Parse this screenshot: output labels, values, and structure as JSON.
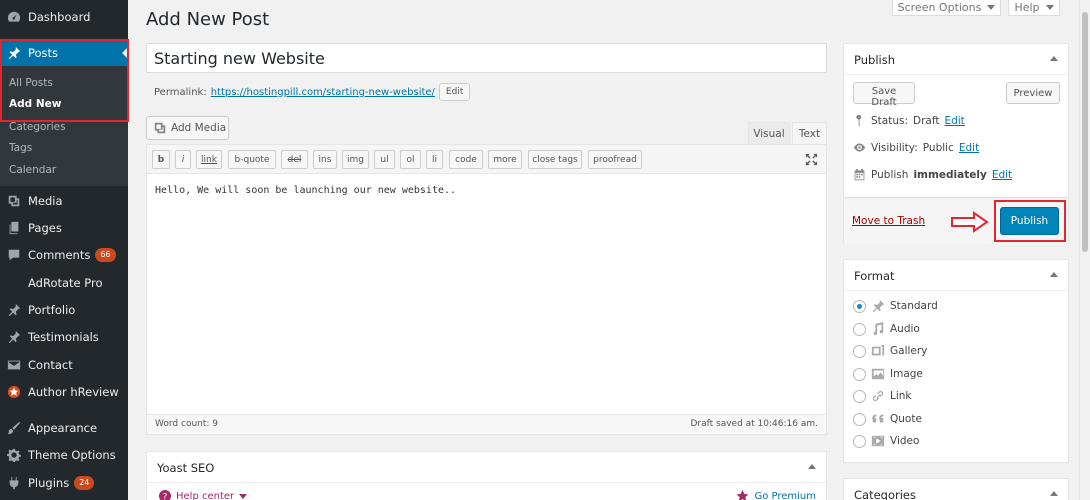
{
  "sidebar": {
    "items": [
      {
        "label": "Dashboard",
        "icon": "dashboard-icon"
      },
      {
        "label": "Posts",
        "icon": "pin-icon"
      },
      {
        "label": "Media",
        "icon": "media-icon"
      },
      {
        "label": "Pages",
        "icon": "pages-icon"
      },
      {
        "label": "Comments",
        "icon": "comment-icon",
        "badge": "66"
      },
      {
        "label": "AdRotate Pro"
      },
      {
        "label": "Portfolio",
        "icon": "pin-icon"
      },
      {
        "label": "Testimonials",
        "icon": "pin-icon"
      },
      {
        "label": "Contact",
        "icon": "mail-icon"
      },
      {
        "label": "Author hReview",
        "icon": "star-icon"
      },
      {
        "label": "Appearance",
        "icon": "brush-icon"
      },
      {
        "label": "Theme Options",
        "icon": "gear-icon"
      },
      {
        "label": "Plugins",
        "icon": "plug-icon",
        "badge": "24"
      }
    ],
    "submenu": [
      "All Posts",
      "Add New",
      "Categories",
      "Tags",
      "Calendar"
    ]
  },
  "header": {
    "title": "Add New Post",
    "screen_options": "Screen Options",
    "help": "Help"
  },
  "post": {
    "title": "Starting new Website",
    "permalink_label": "Permalink:",
    "permalink_url": "https://hostingpill.com/starting-new-website/",
    "permalink_edit": "Edit"
  },
  "editor": {
    "add_media": "Add Media",
    "tab_visual": "Visual",
    "tab_text": "Text",
    "quicktags": [
      "b",
      "i",
      "link",
      "b-quote",
      "del",
      "ins",
      "img",
      "ul",
      "ol",
      "li",
      "code",
      "more",
      "close tags",
      "proofread"
    ],
    "content": "Hello, We will soon be launching our new website..",
    "word_count": "Word count: 9",
    "draft_saved": "Draft saved at 10:46:16 am."
  },
  "yoast": {
    "title": "Yoast SEO",
    "help_center": "Help center",
    "go_premium": "Go Premium"
  },
  "publish_box": {
    "title": "Publish",
    "save_draft": "Save Draft",
    "preview": "Preview",
    "status_label": "Status:",
    "status_value": "Draft",
    "visibility_label": "Visibility:",
    "visibility_value": "Public",
    "schedule_label": "Publish",
    "schedule_value": "immediately",
    "edit": "Edit",
    "move_to_trash": "Move to Trash",
    "publish": "Publish"
  },
  "format_box": {
    "title": "Format",
    "options": [
      {
        "label": "Standard",
        "icon": "pin-icon",
        "checked": true
      },
      {
        "label": "Audio",
        "icon": "audio-icon"
      },
      {
        "label": "Gallery",
        "icon": "gallery-icon"
      },
      {
        "label": "Image",
        "icon": "image-icon"
      },
      {
        "label": "Link",
        "icon": "link-icon"
      },
      {
        "label": "Quote",
        "icon": "quote-icon"
      },
      {
        "label": "Video",
        "icon": "video-icon"
      }
    ]
  },
  "categories_box": {
    "title": "Categories"
  },
  "colors": {
    "sidebar_bg": "#23282d",
    "active_blue": "#0073aa",
    "publish_blue": "#0085ba",
    "highlight_red": "#e3262d"
  }
}
